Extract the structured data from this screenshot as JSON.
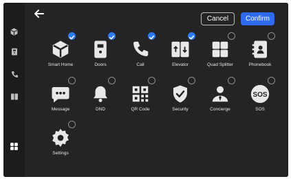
{
  "header": {
    "cancel_label": "Cancel",
    "confirm_label": "Confirm"
  },
  "sidebar": {
    "items": [
      {
        "icon": "smart-home-icon"
      },
      {
        "icon": "door-icon"
      },
      {
        "icon": "phone-icon"
      },
      {
        "icon": "elevator-icon"
      },
      {
        "icon": "apps-grid-icon"
      }
    ]
  },
  "tiles": [
    {
      "label": "Smart Home",
      "icon": "smart-home-icon",
      "selected": true
    },
    {
      "label": "Doors",
      "icon": "door-icon",
      "selected": true
    },
    {
      "label": "Call",
      "icon": "phone-icon",
      "selected": true
    },
    {
      "label": "Elevator",
      "icon": "elevator-icon",
      "selected": true
    },
    {
      "label": "Quad Splitter",
      "icon": "quad-splitter-icon",
      "selected": false
    },
    {
      "label": "Phonebook",
      "icon": "phonebook-icon",
      "selected": false
    },
    {
      "label": "Message",
      "icon": "message-icon",
      "selected": false
    },
    {
      "label": "DND",
      "icon": "bell-icon",
      "selected": false
    },
    {
      "label": "QR Code",
      "icon": "qr-code-icon",
      "selected": false
    },
    {
      "label": "Security",
      "icon": "shield-icon",
      "selected": false
    },
    {
      "label": "Concierge",
      "icon": "concierge-icon",
      "selected": false
    },
    {
      "label": "SOS",
      "icon": "sos-icon",
      "selected": false
    },
    {
      "label": "Settings",
      "icon": "gear-icon",
      "selected": false
    }
  ],
  "colors": {
    "accent": "#2e6bf0",
    "panel": "#242426",
    "sidebar": "#1c1c1e"
  }
}
